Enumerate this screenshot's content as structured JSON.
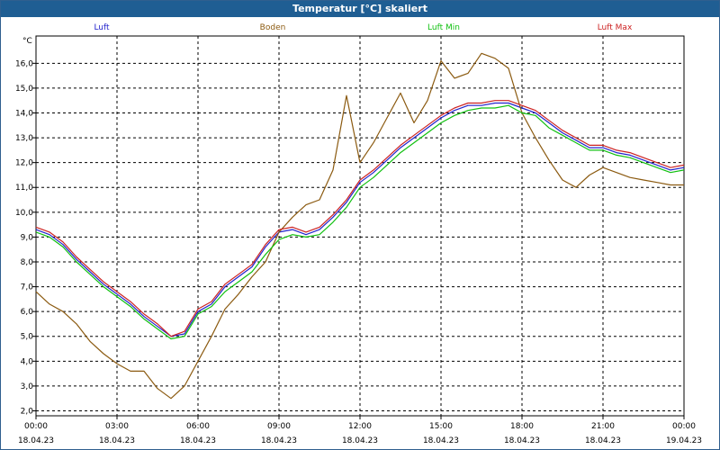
{
  "window": {
    "title": "Temperatur [°C] skaliert"
  },
  "chart_data": {
    "type": "line",
    "title": "Temperatur [°C] skaliert",
    "ylabel": "°C",
    "ylim": [
      1.8,
      17.1
    ],
    "xlim_hours": [
      0,
      24
    ],
    "grid": true,
    "legend_placement": "top",
    "y_ticks": [
      "2,0",
      "3,0",
      "4,0",
      "5,0",
      "6,0",
      "7,0",
      "8,0",
      "9,0",
      "10,0",
      "11,0",
      "12,0",
      "13,0",
      "14,0",
      "15,0",
      "16,0"
    ],
    "x_ticks": [
      {
        "time": "00:00",
        "date": "18.04.23"
      },
      {
        "time": "03:00",
        "date": "18.04.23"
      },
      {
        "time": "06:00",
        "date": "18.04.23"
      },
      {
        "time": "09:00",
        "date": "18.04.23"
      },
      {
        "time": "12:00",
        "date": "18.04.23"
      },
      {
        "time": "15:00",
        "date": "18.04.23"
      },
      {
        "time": "18:00",
        "date": "18.04.23"
      },
      {
        "time": "21:00",
        "date": "18.04.23"
      },
      {
        "time": "00:00",
        "date": "19.04.23"
      }
    ],
    "series": [
      {
        "name": "Luft",
        "color": "#2222cc",
        "x": [
          0,
          0.5,
          1,
          1.5,
          2,
          2.5,
          3,
          3.5,
          4,
          4.5,
          5,
          5.5,
          6,
          6.5,
          7,
          7.5,
          8,
          8.5,
          9,
          9.5,
          10,
          10.5,
          11,
          11.5,
          12,
          12.5,
          13,
          13.5,
          14,
          14.5,
          15,
          15.5,
          16,
          16.5,
          17,
          17.5,
          18,
          18.5,
          19,
          19.5,
          20,
          20.5,
          21,
          21.5,
          22,
          22.5,
          23,
          23.5,
          24
        ],
        "values": [
          9.3,
          9.1,
          8.7,
          8.1,
          7.6,
          7.1,
          6.7,
          6.3,
          5.8,
          5.4,
          5.0,
          5.1,
          6.0,
          6.3,
          7.0,
          7.4,
          7.8,
          8.6,
          9.2,
          9.3,
          9.1,
          9.3,
          9.8,
          10.4,
          11.2,
          11.6,
          12.1,
          12.6,
          13.0,
          13.4,
          13.8,
          14.1,
          14.3,
          14.3,
          14.4,
          14.4,
          14.2,
          14.0,
          13.6,
          13.2,
          12.9,
          12.6,
          12.6,
          12.4,
          12.3,
          12.1,
          11.9,
          11.7,
          11.8
        ]
      },
      {
        "name": "Boden",
        "color": "#8b5a10",
        "x": [
          0,
          0.5,
          1,
          1.5,
          2,
          2.5,
          3,
          3.5,
          4,
          4.5,
          5,
          5.5,
          6,
          6.5,
          7,
          7.5,
          8,
          8.5,
          9,
          9.5,
          10,
          10.5,
          11,
          11.5,
          12,
          12.5,
          13,
          13.5,
          14,
          14.5,
          15,
          15.5,
          16,
          16.5,
          17,
          17.5,
          18,
          18.5,
          19,
          19.5,
          20,
          20.5,
          21,
          21.5,
          22,
          22.5,
          23,
          23.5,
          24
        ],
        "values": [
          6.8,
          6.3,
          6.0,
          5.5,
          4.8,
          4.3,
          3.9,
          3.6,
          3.6,
          2.9,
          2.5,
          3.0,
          4.0,
          5.0,
          6.1,
          6.7,
          7.4,
          8.0,
          9.2,
          9.8,
          10.3,
          10.5,
          11.7,
          14.7,
          12.0,
          12.8,
          13.8,
          14.8,
          13.6,
          14.5,
          16.1,
          15.4,
          15.6,
          16.4,
          16.2,
          15.8,
          14.0,
          13.0,
          12.1,
          11.3,
          11.0,
          11.5,
          11.8,
          11.6,
          11.4,
          11.3,
          11.2,
          11.1,
          11.1
        ]
      },
      {
        "name": "Luft Min",
        "color": "#10c010",
        "x": [
          0,
          0.5,
          1,
          1.5,
          2,
          2.5,
          3,
          3.5,
          4,
          4.5,
          5,
          5.5,
          6,
          6.5,
          7,
          7.5,
          8,
          8.5,
          9,
          9.5,
          10,
          10.5,
          11,
          11.5,
          12,
          12.5,
          13,
          13.5,
          14,
          14.5,
          15,
          15.5,
          16,
          16.5,
          17,
          17.5,
          18,
          18.5,
          19,
          19.5,
          20,
          20.5,
          21,
          21.5,
          22,
          22.5,
          23,
          23.5,
          24
        ],
        "values": [
          9.2,
          9.0,
          8.6,
          8.0,
          7.5,
          7.0,
          6.6,
          6.2,
          5.7,
          5.3,
          4.9,
          5.0,
          5.9,
          6.2,
          6.8,
          7.2,
          7.6,
          8.3,
          8.9,
          9.1,
          9.0,
          9.1,
          9.6,
          10.2,
          11.0,
          11.4,
          11.9,
          12.4,
          12.8,
          13.2,
          13.6,
          13.9,
          14.1,
          14.2,
          14.2,
          14.3,
          14.0,
          13.9,
          13.4,
          13.1,
          12.8,
          12.5,
          12.5,
          12.3,
          12.2,
          12.0,
          11.8,
          11.6,
          11.7
        ]
      },
      {
        "name": "Luft Max",
        "color": "#cc2222",
        "x": [
          0,
          0.5,
          1,
          1.5,
          2,
          2.5,
          3,
          3.5,
          4,
          4.5,
          5,
          5.5,
          6,
          6.5,
          7,
          7.5,
          8,
          8.5,
          9,
          9.5,
          10,
          10.5,
          11,
          11.5,
          12,
          12.5,
          13,
          13.5,
          14,
          14.5,
          15,
          15.5,
          16,
          16.5,
          17,
          17.5,
          18,
          18.5,
          19,
          19.5,
          20,
          20.5,
          21,
          21.5,
          22,
          22.5,
          23,
          23.5,
          24
        ],
        "values": [
          9.4,
          9.2,
          8.8,
          8.2,
          7.7,
          7.2,
          6.8,
          6.4,
          5.9,
          5.5,
          5.0,
          5.2,
          6.1,
          6.4,
          7.1,
          7.5,
          7.9,
          8.7,
          9.3,
          9.4,
          9.2,
          9.4,
          9.9,
          10.5,
          11.3,
          11.7,
          12.2,
          12.7,
          13.1,
          13.5,
          13.9,
          14.2,
          14.4,
          14.4,
          14.5,
          14.5,
          14.3,
          14.1,
          13.7,
          13.3,
          13.0,
          12.7,
          12.7,
          12.5,
          12.4,
          12.2,
          12.0,
          11.8,
          11.9
        ]
      }
    ]
  }
}
